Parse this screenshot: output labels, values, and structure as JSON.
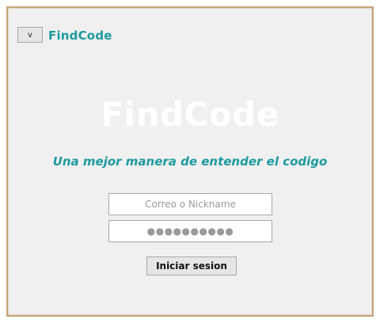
{
  "header": {
    "menu_button_label": "v",
    "brand_small": "FindCode"
  },
  "hero": {
    "brand_large": "FindCode",
    "tagline": "Una mejor manera de entender el codigo"
  },
  "login": {
    "user_placeholder": "Correo o Nickname",
    "user_value": "",
    "password_masked": "●●●●●●●●●●",
    "submit_label": "Iniciar sesion"
  },
  "colors": {
    "accent": "#1e9aa0",
    "frame_border": "#c8a57a",
    "background": "#f0f0f0"
  }
}
